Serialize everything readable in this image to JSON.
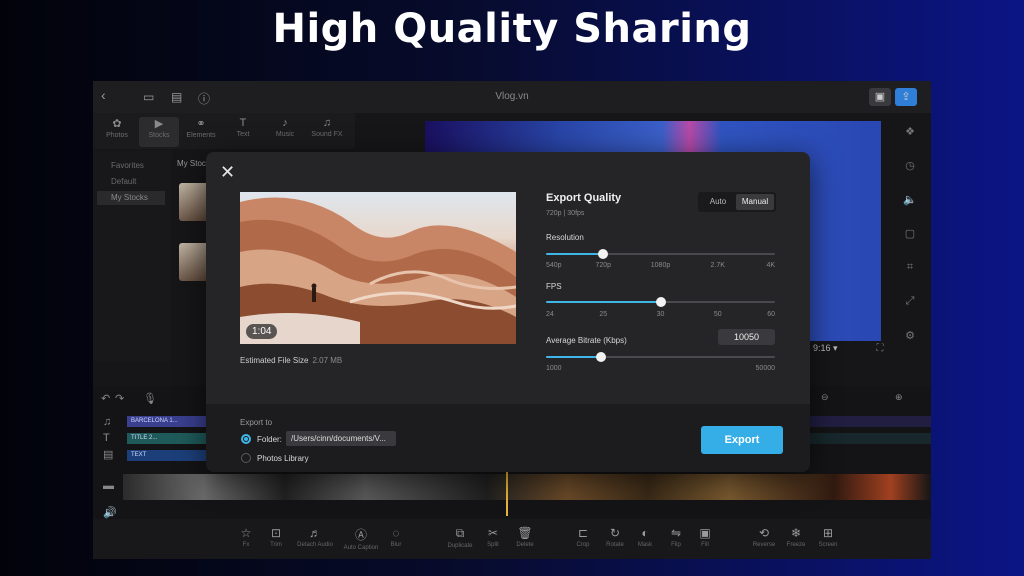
{
  "banner": {
    "title": "High Quality Sharing"
  },
  "app": {
    "title": "Vlog.vn",
    "tools": [
      {
        "label": "Photos",
        "icon": "photos-icon"
      },
      {
        "label": "Stocks",
        "icon": "stocks-icon"
      },
      {
        "label": "Elements",
        "icon": "elements-icon"
      },
      {
        "label": "Text",
        "icon": "text-icon"
      },
      {
        "label": "Music",
        "icon": "music-icon"
      },
      {
        "label": "Sound FX",
        "icon": "sound-fx-icon"
      }
    ],
    "sidebar": [
      {
        "label": "Favorites"
      },
      {
        "label": "Default"
      },
      {
        "label": "My Stocks"
      }
    ],
    "media_heading": "My Stock",
    "ratio_label": "9:16 ▾",
    "tracks": [
      {
        "label": "BARCELONA 1...",
        "color": "#3a3f8f"
      },
      {
        "label": "TITLE 2...",
        "color": "#1f5a5a"
      },
      {
        "label": "TEXT",
        "color": "#1c3f7a"
      }
    ],
    "bottom_tools": [
      {
        "label": "Fx",
        "icon": "star-icon"
      },
      {
        "label": "Trim",
        "icon": "trim-icon"
      },
      {
        "label": "Detach Audio",
        "icon": "detach-audio-icon"
      },
      {
        "label": "Auto Caption",
        "icon": "auto-caption-icon"
      },
      {
        "label": "Blur",
        "icon": "blur-icon"
      },
      {
        "label": "Duplicate",
        "icon": "duplicate-icon"
      },
      {
        "label": "Split",
        "icon": "split-icon"
      },
      {
        "label": "Delete",
        "icon": "delete-icon"
      },
      {
        "label": "Crop",
        "icon": "crop-icon"
      },
      {
        "label": "Rotate",
        "icon": "rotate-icon"
      },
      {
        "label": "Mask",
        "icon": "mask-icon"
      },
      {
        "label": "Flip",
        "icon": "flip-icon"
      },
      {
        "label": "Fill",
        "icon": "fill-icon"
      },
      {
        "label": "Reverse",
        "icon": "reverse-icon"
      },
      {
        "label": "Freeze",
        "icon": "freeze-icon"
      },
      {
        "label": "Screen",
        "icon": "screen-icon"
      }
    ]
  },
  "export": {
    "timecode": "1:04",
    "file_size_label": "Estimated File Size",
    "file_size_value": "2.07 MB",
    "quality_title": "Export Quality",
    "quality_sub": "720p | 30fps",
    "mode_auto": "Auto",
    "mode_manual": "Manual",
    "mode_selected": "Manual",
    "resolution_label": "Resolution",
    "resolution_ticks": [
      "540p",
      "720p",
      "1080p",
      "2.7K",
      "4K"
    ],
    "resolution_selected": "720p",
    "fps_label": "FPS",
    "fps_ticks": [
      "24",
      "25",
      "30",
      "50",
      "60"
    ],
    "fps_selected": "30",
    "bitrate_label": "Average Bitrate (Kbps)",
    "bitrate_value": "10050",
    "bitrate_min": "1000",
    "bitrate_max": "50000",
    "export_to_label": "Export to",
    "folder_label": "Folder:",
    "folder_path": "/Users/cinn/documents/V...",
    "photos_label": "Photos Library",
    "destination_selected": "Folder",
    "export_button": "Export",
    "accent_color": "#35aee8"
  }
}
